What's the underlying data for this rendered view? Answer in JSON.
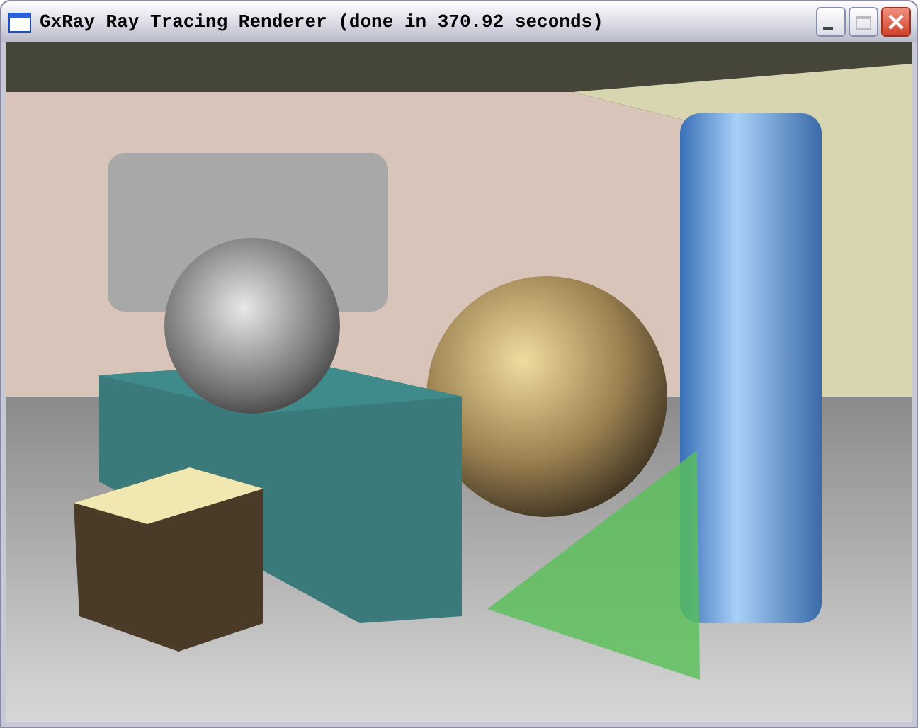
{
  "window": {
    "title": "GxRay Ray Tracing Renderer (done in 370.92 seconds)",
    "controls": [
      {
        "kind": "minimize"
      },
      {
        "kind": "maximize"
      },
      {
        "kind": "close"
      }
    ]
  },
  "render": {
    "kind": "scene"
  }
}
